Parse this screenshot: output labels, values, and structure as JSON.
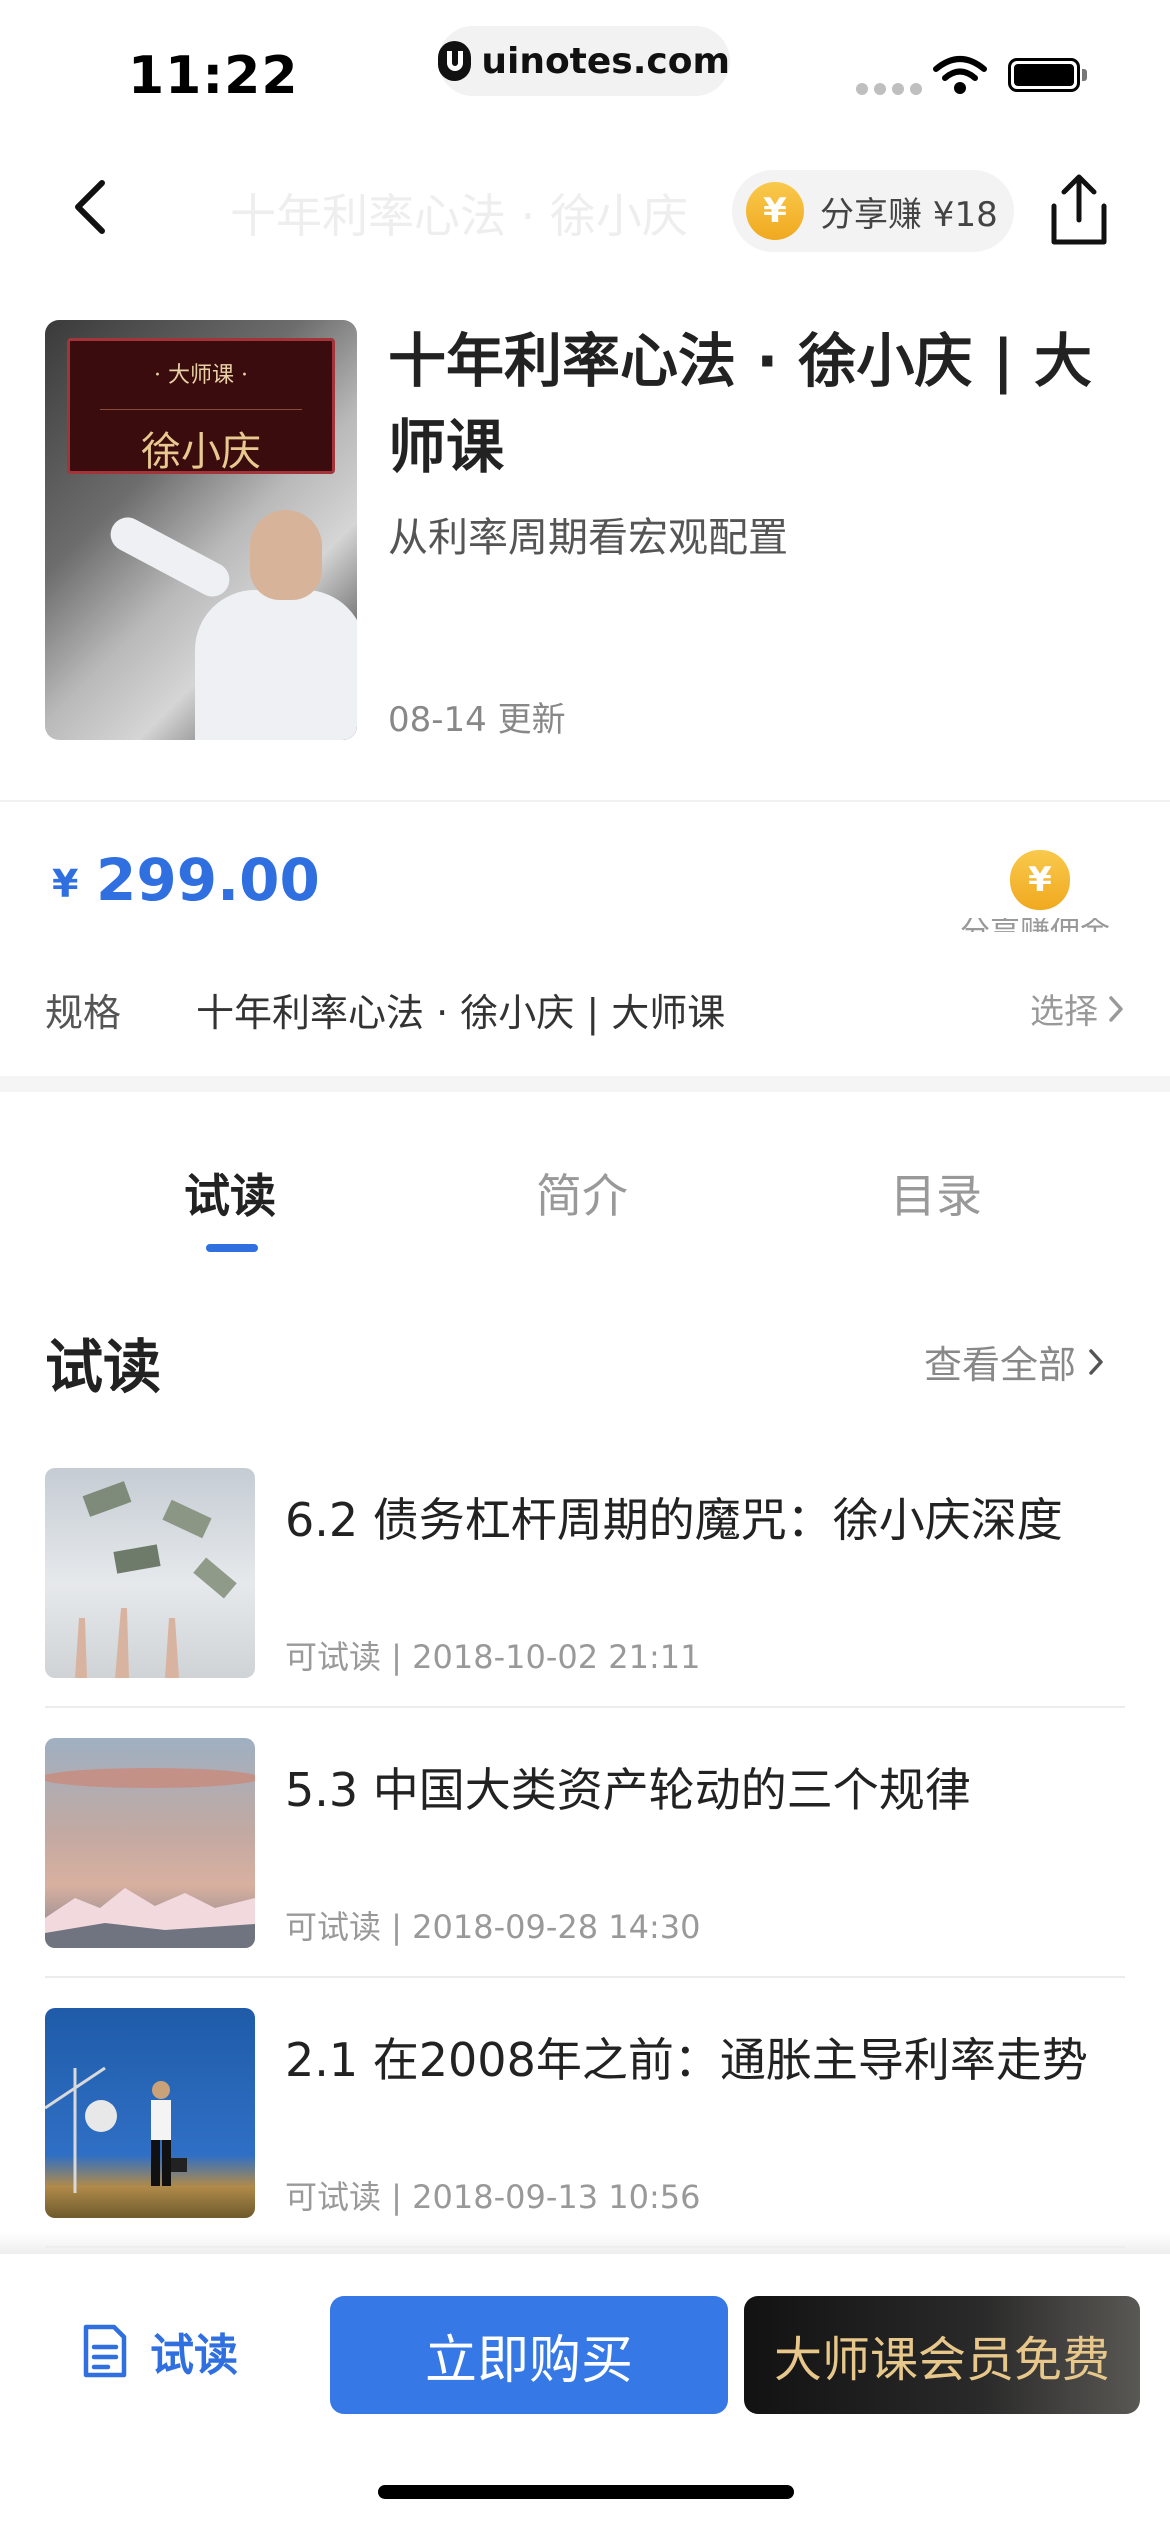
{
  "status_bar": {
    "time": "11:22",
    "url": "uinotes.com"
  },
  "nav": {
    "ghost_title": "十年利率心法 · 徐小庆",
    "share_earn_label": "分享赚 ¥18",
    "coin_symbol": "¥"
  },
  "product": {
    "cover_badge_top": "· 大师课 ·",
    "cover_badge_name": "徐小庆",
    "title": "十年利率心法 · 徐小庆 | 大师课",
    "subtitle": "从利率周期看宏观配置",
    "update": "08-14 更新"
  },
  "price": {
    "currency": "¥",
    "value": "299.00",
    "share_label": "分享赚佣金"
  },
  "spec": {
    "label": "规格",
    "value": "十年利率心法 · 徐小庆 | 大师课",
    "select": "选择"
  },
  "tabs": [
    {
      "label": "试读",
      "active": true
    },
    {
      "label": "简介",
      "active": false
    },
    {
      "label": "目录",
      "active": false
    }
  ],
  "section": {
    "title": "试读",
    "see_all": "查看全部"
  },
  "items": [
    {
      "title": "6.2 债务杠杆周期的魔咒：徐小庆深度",
      "meta": "可试读 | 2018-10-02 21:11"
    },
    {
      "title": "5.3 中国大类资产轮动的三个规律",
      "meta": "可试读 | 2018-09-28 14:30"
    },
    {
      "title": "2.1 在2008年之前：通胀主导利率走势",
      "meta": "可试读 | 2018-09-13 10:56"
    }
  ],
  "bottom": {
    "trial_label": "试读",
    "buy_label": "立即购买",
    "member_label": "大师课会员免费"
  },
  "colors": {
    "accent": "#2f6fe0",
    "buy_button": "#3679e6",
    "coin": "#f5b42f",
    "member_text": "#e8c78a"
  }
}
